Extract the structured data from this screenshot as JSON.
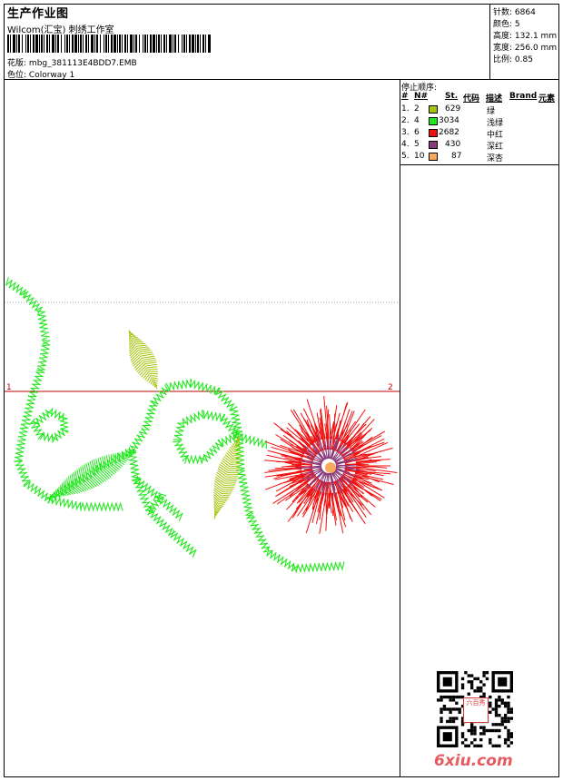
{
  "header": {
    "title": "生产作业图",
    "subtitle": "Wilcom(汇宝) 刺绣工作室",
    "design_label": "花版:",
    "design_file": "mbg_381113E4BDD7.EMB",
    "colorway_label": "色位:",
    "colorway": "Colorway 1"
  },
  "stats": [
    {
      "label": "针数:",
      "value": "6864"
    },
    {
      "label": "颜色:",
      "value": "5"
    },
    {
      "label": "高度:",
      "value": "132.1 mm"
    },
    {
      "label": "宽度:",
      "value": "256.0 mm"
    },
    {
      "label": "比例:",
      "value": "0.85"
    }
  ],
  "stop_sequence": {
    "title": "停止顺序:",
    "headers": [
      "#",
      "N#",
      "St.",
      "代码",
      "描述",
      "Brand",
      "元素"
    ],
    "rows": [
      {
        "index": "1.",
        "needle": "2",
        "color": "#a4c40a",
        "stitches": "629",
        "desc": "绿"
      },
      {
        "index": "2.",
        "needle": "4",
        "color": "#22e81e",
        "stitches": "3034",
        "desc": "浅绿"
      },
      {
        "index": "3.",
        "needle": "6",
        "color": "#f01010",
        "stitches": "2682",
        "desc": "中红"
      },
      {
        "index": "4.",
        "needle": "5",
        "color": "#8a3a7a",
        "stitches": "430",
        "desc": "深红"
      },
      {
        "index": "5.",
        "needle": "10",
        "color": "#f8aa5c",
        "stitches": "87",
        "desc": "深杏"
      }
    ]
  },
  "canvas": {
    "guide_start": "1",
    "guide_end": "2",
    "colors": {
      "stem": "#22e81e",
      "leaf_olive": "#a4c40a",
      "petal": "#f01010",
      "inner": "#8a3a7a",
      "center": "#f8aa5c",
      "guide": "#c00000"
    }
  },
  "watermark": {
    "logo_text": "6xiu.com",
    "seal_text": "六百秀"
  }
}
